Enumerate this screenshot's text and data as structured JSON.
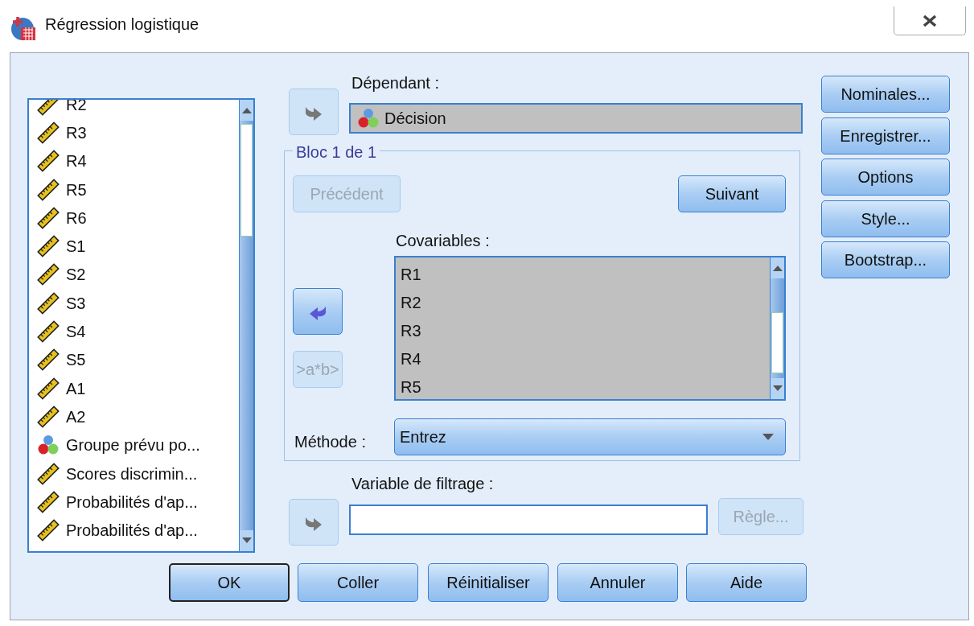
{
  "window": {
    "title": "Régression logistique"
  },
  "variables": [
    {
      "name": "R2",
      "kind": "scale"
    },
    {
      "name": "R3",
      "kind": "scale"
    },
    {
      "name": "R4",
      "kind": "scale"
    },
    {
      "name": "R5",
      "kind": "scale"
    },
    {
      "name": "R6",
      "kind": "scale"
    },
    {
      "name": "S1",
      "kind": "scale"
    },
    {
      "name": "S2",
      "kind": "scale"
    },
    {
      "name": "S3",
      "kind": "scale"
    },
    {
      "name": "S4",
      "kind": "scale"
    },
    {
      "name": "S5",
      "kind": "scale"
    },
    {
      "name": "A1",
      "kind": "scale"
    },
    {
      "name": "A2",
      "kind": "scale"
    },
    {
      "name": "Groupe prévu po...",
      "kind": "nominal"
    },
    {
      "name": "Scores discrimin...",
      "kind": "scale"
    },
    {
      "name": "Probabilités d'ap...",
      "kind": "scale"
    },
    {
      "name": "Probabilités d'ap...",
      "kind": "scale"
    }
  ],
  "dependent": {
    "label": "Dépendant :",
    "arrow": {
      "disabled": true
    },
    "variable": {
      "name": "Décision",
      "kind": "nominal"
    }
  },
  "block": {
    "title": "Bloc 1 de 1",
    "previous": {
      "label": "Précédent",
      "disabled": true
    },
    "next": {
      "label": "Suivant",
      "disabled": false
    },
    "covariates_label": "Covariables :",
    "arrow": {
      "disabled": false
    },
    "covariates": [
      "R1",
      "R2",
      "R3",
      "R4",
      "R5"
    ],
    "interaction": {
      "label": ">a*b>",
      "disabled": true
    },
    "method": {
      "label": "Méthode :",
      "value": "Entrez"
    }
  },
  "filter": {
    "label": "Variable de filtrage :",
    "arrow": {
      "disabled": true
    },
    "rule": {
      "label": "Règle...",
      "disabled": true
    }
  },
  "side_buttons": [
    {
      "label": "Nominales..."
    },
    {
      "label": "Enregistrer..."
    },
    {
      "label": "Options"
    },
    {
      "label": "Style..."
    },
    {
      "label": "Bootstrap..."
    }
  ],
  "buttons": [
    {
      "label": "OK",
      "default": true
    },
    {
      "label": "Coller",
      "default": false
    },
    {
      "label": "Réinitialiser",
      "default": false
    },
    {
      "label": "Annuler",
      "default": false
    },
    {
      "label": "Aide",
      "default": false
    }
  ]
}
